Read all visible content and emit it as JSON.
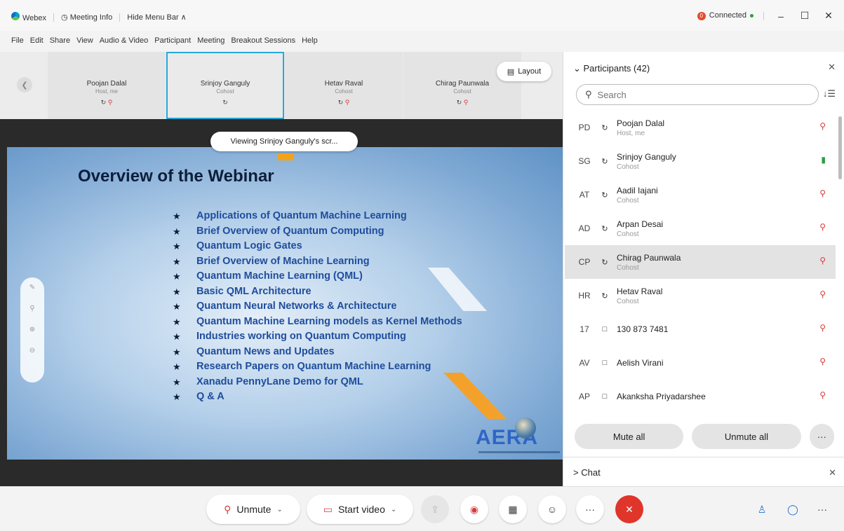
{
  "titlebar": {
    "app_name": "Webex",
    "meeting_info": "Meeting Info",
    "hide_menu": "Hide Menu Bar ∧",
    "status": "Connected",
    "status_icon": "0",
    "minimize": "–",
    "maximize": "☐",
    "close": "✕"
  },
  "menu": [
    "File",
    "Edit",
    "Share",
    "View",
    "Audio & Video",
    "Participant",
    "Meeting",
    "Breakout Sessions",
    "Help"
  ],
  "filmstrip": {
    "tiles": [
      {
        "name": "Poojan Dalal",
        "role": "Host, me"
      },
      {
        "name": "Srinjoy Ganguly",
        "role": "Cohost"
      },
      {
        "name": "Hetav Raval",
        "role": "Cohost"
      },
      {
        "name": "Chirag Paunwala",
        "role": "Cohost"
      }
    ],
    "layout_label": "Layout"
  },
  "viewing_banner": "Viewing Srinjoy Ganguly's scr...",
  "slide": {
    "title": "Overview of the Webinar",
    "logo_text": "AERA",
    "bullets": [
      "Applications of Quantum Machine Learning",
      "Brief Overview of Quantum Computing",
      "Quantum Logic Gates",
      "Brief Overview of Machine Learning",
      "Quantum Machine Learning (QML)",
      "Basic QML Architecture",
      "Quantum Neural Networks & Architecture",
      "Quantum Machine Learning models as Kernel Methods",
      "Industries working on Quantum Computing",
      "Quantum News and Updates",
      "Research Papers on Quantum Machine Learning",
      "Xanadu PennyLane Demo for QML",
      "Q & A"
    ]
  },
  "participants": {
    "header": "Participants (42)",
    "search_placeholder": "Search",
    "list": [
      {
        "initials": "PD",
        "name": "Poojan Dalal",
        "role": "Host, me",
        "conn": "↻",
        "mic": "off"
      },
      {
        "initials": "SG",
        "name": "Srinjoy Ganguly",
        "role": "Cohost",
        "conn": "↻",
        "mic": "on"
      },
      {
        "initials": "AT",
        "name": "Aadil Iajani",
        "role": "Cohost",
        "conn": "↻",
        "mic": "off"
      },
      {
        "initials": "AD",
        "name": "Arpan Desai",
        "role": "Cohost",
        "conn": "↻",
        "mic": "off"
      },
      {
        "initials": "CP",
        "name": "Chirag Paunwala",
        "role": "Cohost",
        "conn": "↻",
        "mic": "off",
        "selected": true
      },
      {
        "initials": "HR",
        "name": "Hetav Raval",
        "role": "Cohost",
        "conn": "↻",
        "mic": "off"
      },
      {
        "initials": "17",
        "name": "130 873 7481",
        "role": "",
        "conn": "□",
        "mic": "off"
      },
      {
        "initials": "AV",
        "name": "Aelish Virani",
        "role": "",
        "conn": "□",
        "mic": "off"
      },
      {
        "initials": "AP",
        "name": "Akanksha Priyadarshee",
        "role": "",
        "conn": "□",
        "mic": "off"
      }
    ],
    "mute_all": "Mute all",
    "unmute_all": "Unmute all",
    "more": "···"
  },
  "chat": {
    "label": "Chat",
    "collapse_icon": "chevron-right-icon"
  },
  "controls": {
    "unmute": "Unmute",
    "start_video": "Start video",
    "more": "···"
  },
  "colors": {
    "accent": "#26a8d8",
    "end_call": "#e0352b",
    "mic_muted": "#d63b3b",
    "mic_active": "#2e9c43",
    "slide_text": "#1f4d9c"
  }
}
